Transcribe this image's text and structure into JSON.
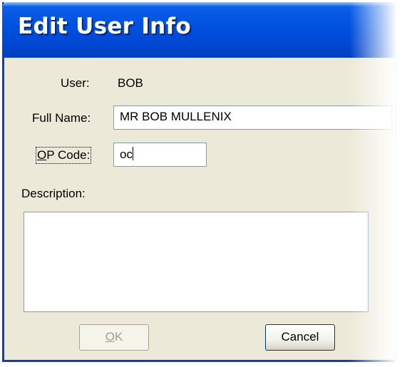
{
  "window": {
    "title": "Edit User Info"
  },
  "form": {
    "user_label": "User:",
    "user_value": "BOB",
    "full_name_label": "Full Name:",
    "full_name_value": "MR BOB MULLENIX",
    "op_code_label_accel": "O",
    "op_code_label_rest": "P Code:",
    "op_code_value": "oc",
    "description_label": "Description:",
    "description_value": ""
  },
  "buttons": {
    "ok_accel": "O",
    "ok_rest": "K",
    "ok_enabled": false,
    "cancel_label": "Cancel"
  }
}
